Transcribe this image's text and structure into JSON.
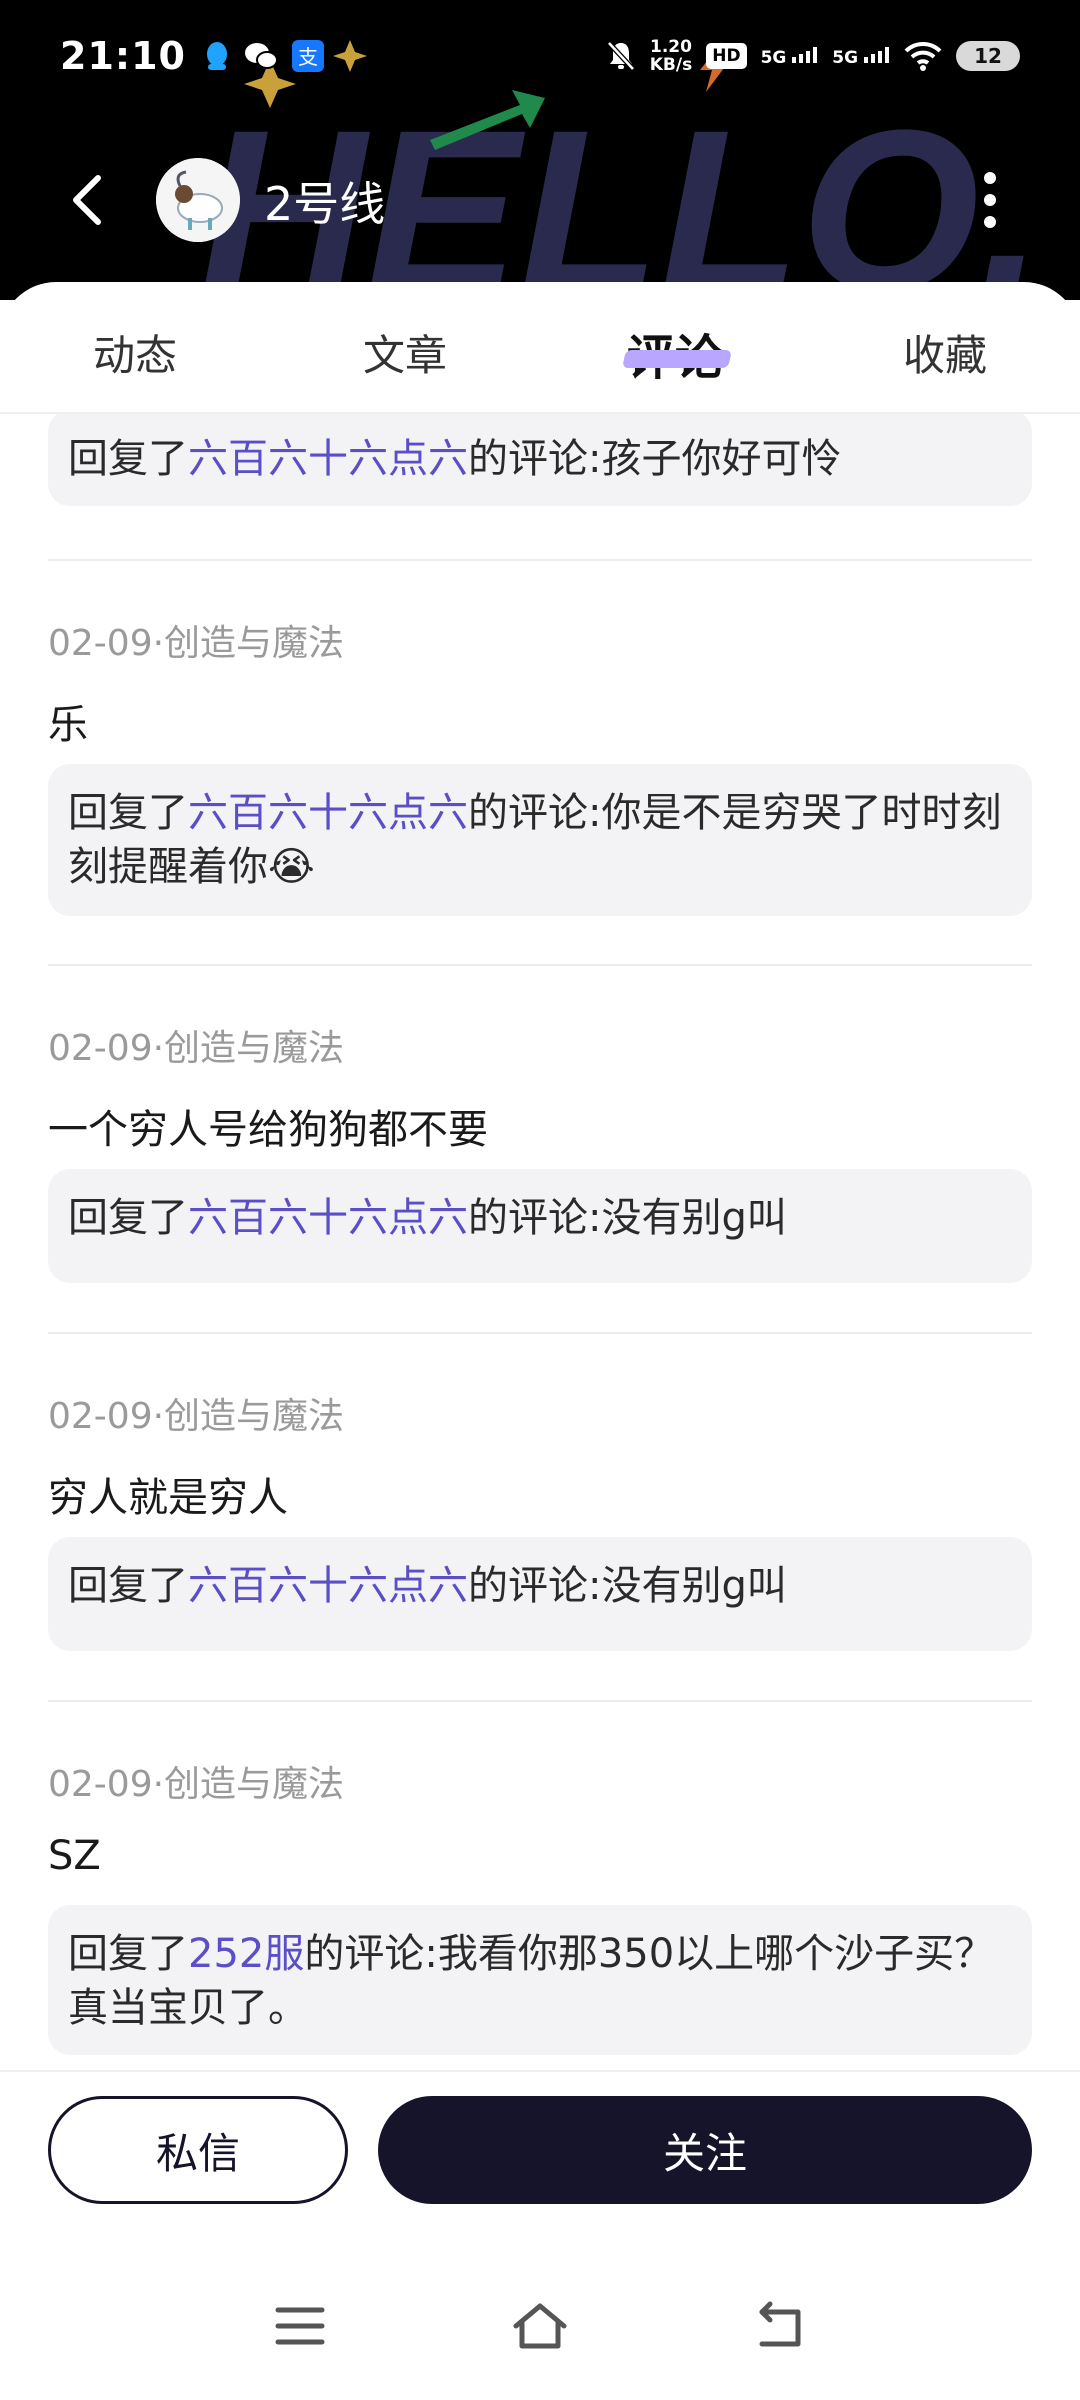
{
  "status_bar": {
    "time": "21:10",
    "net_speed_value": "1.20",
    "net_speed_unit": "KB/s",
    "hd_label": "HD",
    "signal1": "5G",
    "signal2": "5G",
    "battery": "12"
  },
  "profile": {
    "name": "2号线",
    "header_art_text": "HELLO."
  },
  "tabs": [
    {
      "label": "动态",
      "active": false
    },
    {
      "label": "文章",
      "active": false
    },
    {
      "label": "评论",
      "active": true
    },
    {
      "label": "收藏",
      "active": false
    }
  ],
  "comments": [
    {
      "meta": "",
      "text": "",
      "reply_prefix": "回复了",
      "reply_target": "六百六十六点六",
      "reply_suffix": "的评论:孩子你好可怜"
    },
    {
      "meta": "02-09·创造与魔法",
      "text": "乐",
      "reply_prefix": "回复了",
      "reply_target": "六百六十六点六",
      "reply_suffix": "的评论:你是不是穷哭了时时刻刻提醒着你😭"
    },
    {
      "meta": "02-09·创造与魔法",
      "text": "一个穷人号给狗狗都不要",
      "reply_prefix": "回复了",
      "reply_target": "六百六十六点六",
      "reply_suffix": "的评论:没有别g叫"
    },
    {
      "meta": "02-09·创造与魔法",
      "text": "穷人就是穷人",
      "reply_prefix": "回复了",
      "reply_target": "六百六十六点六",
      "reply_suffix": "的评论:没有别g叫"
    },
    {
      "meta": "02-09·创造与魔法",
      "text": "SZ",
      "reply_prefix": "回复了",
      "reply_target": "252服",
      "reply_suffix": "的评论:我看你那350以上哪个沙子买？真当宝贝了。"
    }
  ],
  "actions": {
    "dm_label": "私信",
    "follow_label": "关注"
  },
  "colors": {
    "mention": "#5b4fc7",
    "primary_dark": "#15142a",
    "tab_highlight": "#b9a7ff"
  }
}
